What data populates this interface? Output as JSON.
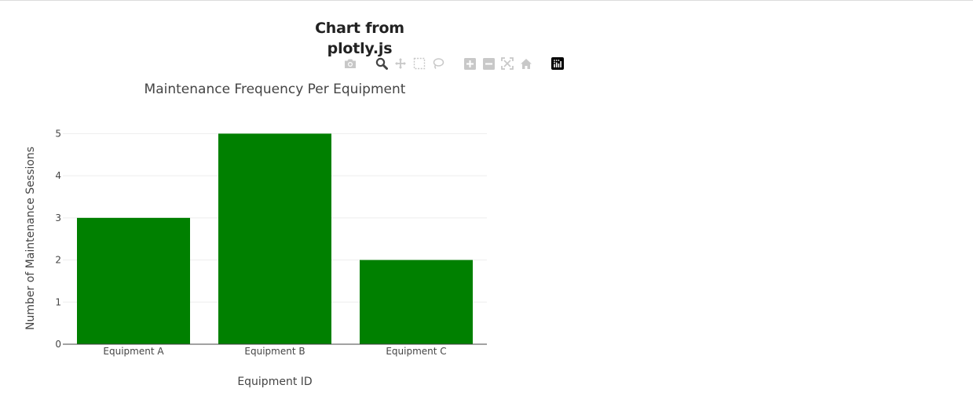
{
  "page": {
    "title": "Chart from plotly.js"
  },
  "modebar": {
    "buttons": [
      {
        "icon": "camera-icon",
        "name": "download-png-button"
      },
      {
        "icon": "zoom-icon",
        "name": "zoom-button"
      },
      {
        "icon": "pan-icon",
        "name": "pan-button"
      },
      {
        "icon": "box-select-icon",
        "name": "box-select-button"
      },
      {
        "icon": "lasso-select-icon",
        "name": "lasso-select-button"
      },
      {
        "icon": "zoom-in-icon",
        "name": "zoom-in-button"
      },
      {
        "icon": "zoom-out-icon",
        "name": "zoom-out-button"
      },
      {
        "icon": "autoscale-icon",
        "name": "autoscale-button"
      },
      {
        "icon": "reset-axes-icon",
        "name": "reset-axes-button"
      },
      {
        "icon": "plotly-logo-icon",
        "name": "plotly-logo-link"
      }
    ],
    "active_color": "#444444",
    "inactive_color": "#c8c8c8"
  },
  "chart_data": {
    "type": "bar",
    "title": "Maintenance Frequency Per Equipment",
    "xlabel": "Equipment ID",
    "ylabel": "Number of Maintenance Sessions",
    "categories": [
      "Equipment A",
      "Equipment B",
      "Equipment C"
    ],
    "values": [
      3,
      5,
      2
    ],
    "ylim": [
      0,
      5.25
    ],
    "yticks": [
      0,
      1,
      2,
      3,
      4,
      5
    ],
    "bar_color": "#008000",
    "grid": true,
    "legend": "none"
  }
}
